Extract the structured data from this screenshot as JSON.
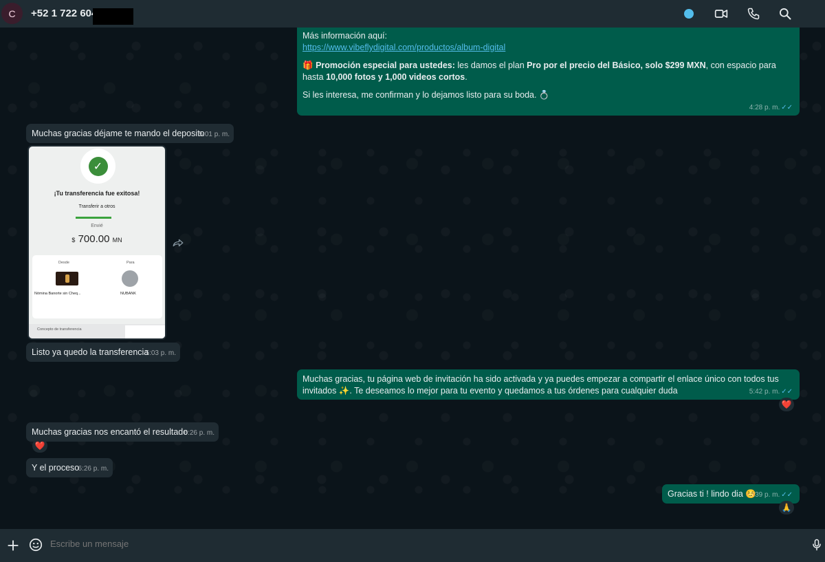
{
  "header": {
    "avatar_letter": "C",
    "contact_name": "+52 1 722 604 :",
    "icons": [
      "status-dot",
      "video-call-icon",
      "phone-icon",
      "search-icon"
    ]
  },
  "messages": [
    {
      "id": "m1",
      "direction": "out",
      "more_info_label": "Más información aquí:",
      "link": "https://www.vibeflydigital.com/productos/album-digital",
      "promo_emoji": "🎁",
      "promo_bold1": "Promoción especial para ustedes:",
      "promo_text1": " les damos el plan ",
      "promo_bold2": "Pro por el precio del Básico, solo $299 MXN",
      "promo_text2": ", con espacio para hasta ",
      "promo_bold3": "10,000 fotos y 1,000 videos cortos",
      "promo_text3": ".",
      "closing": "Si les interesa, me confirman y lo dejamos listo para su boda. 💍",
      "time": "4:28 p. m."
    },
    {
      "id": "m2",
      "direction": "in",
      "text": "Muchas gracias déjame te mando el deposito",
      "time": "5:01 p. m."
    },
    {
      "id": "m3",
      "direction": "in",
      "type": "image",
      "receipt": {
        "title": "¡Tu transferencia fue exitosa!",
        "subtitle": "Transferir a otros",
        "sent_label": "Envié",
        "currency_symbol": "$",
        "amount": "700.00",
        "currency": "MN",
        "from_label": "Desde",
        "to_label": "Para",
        "from_account": "Nómina Banorte sin Cheq...",
        "to_account": "NUBANK",
        "concept_label": "Concepto de transferencia"
      }
    },
    {
      "id": "m4",
      "direction": "in",
      "text": "Listo ya quedo la transferencia",
      "time": "5:03 p. m."
    },
    {
      "id": "m5",
      "direction": "out",
      "text": "Muchas gracias, tu página web de invitación ha sido activada y ya puedes empezar a compartir el enlace único con todos tus invitados ✨. Te deseamos lo mejor para tu evento y quedamos a tus órdenes para cualquier duda",
      "time": "5:42 p. m.",
      "reaction": "❤️"
    },
    {
      "id": "m6",
      "direction": "in",
      "text": "Muchas gracias nos encantó el resultado",
      "time": "6:26 p. m.",
      "reaction": "❤️"
    },
    {
      "id": "m7",
      "direction": "in",
      "text": "Y el proceso",
      "time": "6:26 p. m."
    },
    {
      "id": "m8",
      "direction": "out",
      "text": "Gracias ti ! lindo dia ☺️",
      "time": "6:39 p. m.",
      "reaction": "🙏"
    }
  ],
  "composer": {
    "placeholder": "Escribe un mensaje",
    "icons": [
      "plus-icon",
      "sticker-icon",
      "microphone-icon"
    ]
  },
  "colors": {
    "header_bg": "#1f2c33",
    "chat_bg": "#0b141a",
    "incoming_bubble": "#202c33",
    "outgoing_bubble": "#005c4b",
    "read_ticks": "#53bdeb",
    "status_dot": "#53bdeb"
  }
}
